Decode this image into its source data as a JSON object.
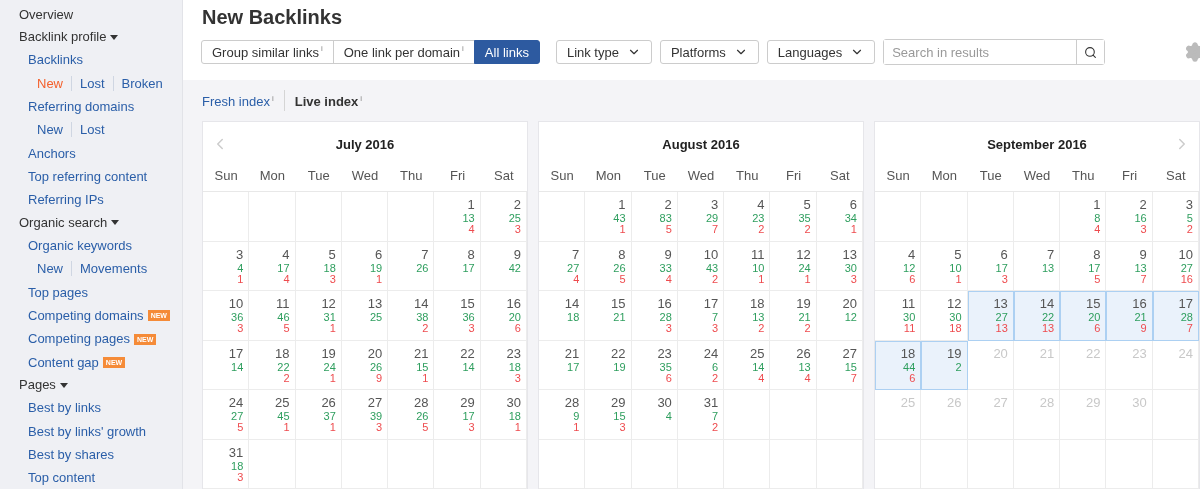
{
  "sidebar": {
    "items": [
      {
        "kind": "top",
        "label": "Overview"
      },
      {
        "kind": "section",
        "label": "Backlink profile",
        "expanded": true,
        "children": [
          {
            "kind": "link",
            "label": "Backlinks"
          },
          {
            "kind": "sublinks",
            "links": [
              {
                "label": "New",
                "selected": true
              },
              {
                "label": "Lost",
                "selected": false
              },
              {
                "label": "Broken",
                "selected": false
              }
            ]
          },
          {
            "kind": "link",
            "label": "Referring domains"
          },
          {
            "kind": "sublinks",
            "links": [
              {
                "label": "New",
                "selected": false
              },
              {
                "label": "Lost",
                "selected": false
              }
            ]
          },
          {
            "kind": "link",
            "label": "Anchors"
          },
          {
            "kind": "link",
            "label": "Top referring content"
          },
          {
            "kind": "link",
            "label": "Referring IPs"
          }
        ]
      },
      {
        "kind": "section",
        "label": "Organic search",
        "expanded": true,
        "children": [
          {
            "kind": "link",
            "label": "Organic keywords"
          },
          {
            "kind": "sublinks",
            "links": [
              {
                "label": "New",
                "selected": false
              },
              {
                "label": "Movements",
                "selected": false
              }
            ]
          },
          {
            "kind": "link",
            "label": "Top pages"
          },
          {
            "kind": "link",
            "label": "Competing domains",
            "badge": "NEW"
          },
          {
            "kind": "link",
            "label": "Competing pages",
            "badge": "NEW"
          },
          {
            "kind": "link",
            "label": "Content gap",
            "badge": "NEW"
          }
        ]
      },
      {
        "kind": "section",
        "label": "Pages",
        "expanded": true,
        "children": [
          {
            "kind": "link",
            "label": "Best by links"
          },
          {
            "kind": "link",
            "label": "Best by links' growth"
          },
          {
            "kind": "link",
            "label": "Best by shares"
          },
          {
            "kind": "link",
            "label": "Top content"
          }
        ]
      }
    ]
  },
  "header": {
    "title": "New Backlinks",
    "link_modes": [
      {
        "label": "Group similar links$^{i}$",
        "selected": false
      },
      {
        "label": "One link per domain$^{i}$",
        "selected": false
      },
      {
        "label": "All links",
        "selected": true
      }
    ],
    "filters": [
      {
        "label": "Link type"
      },
      {
        "label": "Platforms"
      },
      {
        "label": "Languages"
      }
    ],
    "search": {
      "placeholder": "Search in results"
    }
  },
  "index_tabs": [
    {
      "label": "Fresh index$^{i}$",
      "selected": false
    },
    {
      "label": "Live index$^{i}$",
      "selected": true
    }
  ],
  "calendars": [
    {
      "title": "July 2016",
      "weekdays": [
        "Sun",
        "Mon",
        "Tue",
        "Wed",
        "Thu",
        "Fri",
        "Sat"
      ],
      "weeks": [
        [
          {
            "kind": "blank"
          },
          {
            "kind": "blank"
          },
          {
            "kind": "blank"
          },
          {
            "kind": "blank"
          },
          {
            "kind": "blank"
          },
          {
            "kind": "day",
            "day": "1",
            "new": "13",
            "lost": "4",
            "selected": false
          },
          {
            "kind": "day",
            "day": "2",
            "new": "25",
            "lost": "3",
            "selected": false
          }
        ],
        [
          {
            "kind": "day",
            "day": "3",
            "new": "4",
            "lost": "1",
            "selected": false
          },
          {
            "kind": "day",
            "day": "4",
            "new": "17",
            "lost": "4",
            "selected": false
          },
          {
            "kind": "day",
            "day": "5",
            "new": "18",
            "lost": "3",
            "selected": false
          },
          {
            "kind": "day",
            "day": "6",
            "new": "19",
            "lost": "1",
            "selected": false
          },
          {
            "kind": "day",
            "day": "7",
            "new": "26",
            "selected": false
          },
          {
            "kind": "day",
            "day": "8",
            "new": "17",
            "selected": false
          },
          {
            "kind": "day",
            "day": "9",
            "new": "42",
            "selected": false
          }
        ],
        [
          {
            "kind": "day",
            "day": "10",
            "new": "36",
            "lost": "3",
            "selected": false
          },
          {
            "kind": "day",
            "day": "11",
            "new": "46",
            "lost": "5",
            "selected": false
          },
          {
            "kind": "day",
            "day": "12",
            "new": "31",
            "lost": "1",
            "selected": false
          },
          {
            "kind": "day",
            "day": "13",
            "new": "25",
            "selected": false
          },
          {
            "kind": "day",
            "day": "14",
            "new": "38",
            "lost": "2",
            "selected": false
          },
          {
            "kind": "day",
            "day": "15",
            "new": "36",
            "lost": "3",
            "selected": false
          },
          {
            "kind": "day",
            "day": "16",
            "new": "20",
            "lost": "6",
            "selected": false
          }
        ],
        [
          {
            "kind": "day",
            "day": "17",
            "new": "14",
            "selected": false
          },
          {
            "kind": "day",
            "day": "18",
            "new": "22",
            "lost": "2",
            "selected": false
          },
          {
            "kind": "day",
            "day": "19",
            "new": "24",
            "lost": "1",
            "selected": false
          },
          {
            "kind": "day",
            "day": "20",
            "new": "26",
            "lost": "9",
            "selected": false
          },
          {
            "kind": "day",
            "day": "21",
            "new": "15",
            "lost": "1",
            "selected": false
          },
          {
            "kind": "day",
            "day": "22",
            "new": "14",
            "selected": false
          },
          {
            "kind": "day",
            "day": "23",
            "new": "18",
            "lost": "3",
            "selected": false
          }
        ],
        [
          {
            "kind": "day",
            "day": "24",
            "new": "27",
            "lost": "5",
            "selected": false
          },
          {
            "kind": "day",
            "day": "25",
            "new": "45",
            "lost": "1",
            "selected": false
          },
          {
            "kind": "day",
            "day": "26",
            "new": "37",
            "lost": "1",
            "selected": false
          },
          {
            "kind": "day",
            "day": "27",
            "new": "39",
            "lost": "3",
            "selected": false
          },
          {
            "kind": "day",
            "day": "28",
            "new": "26",
            "lost": "5",
            "selected": false
          },
          {
            "kind": "day",
            "day": "29",
            "new": "17",
            "lost": "3",
            "selected": false
          },
          {
            "kind": "day",
            "day": "30",
            "new": "18",
            "lost": "1",
            "selected": false
          }
        ],
        [
          {
            "kind": "day",
            "day": "31",
            "new": "18",
            "lost": "3",
            "selected": false
          },
          {
            "kind": "blank"
          },
          {
            "kind": "blank"
          },
          {
            "kind": "blank"
          },
          {
            "kind": "blank"
          },
          {
            "kind": "blank"
          },
          {
            "kind": "blank"
          }
        ]
      ]
    },
    {
      "title": "August 2016",
      "weekdays": [
        "Sun",
        "Mon",
        "Tue",
        "Wed",
        "Thu",
        "Fri",
        "Sat"
      ],
      "weeks": [
        [
          {
            "kind": "blank"
          },
          {
            "kind": "day",
            "day": "1",
            "new": "43",
            "lost": "1",
            "selected": false
          },
          {
            "kind": "day",
            "day": "2",
            "new": "83",
            "lost": "5",
            "selected": false
          },
          {
            "kind": "day",
            "day": "3",
            "new": "29",
            "lost": "7",
            "selected": false
          },
          {
            "kind": "day",
            "day": "4",
            "new": "23",
            "lost": "2",
            "selected": false
          },
          {
            "kind": "day",
            "day": "5",
            "new": "35",
            "lost": "2",
            "selected": false
          },
          {
            "kind": "day",
            "day": "6",
            "new": "34",
            "lost": "1",
            "selected": false
          }
        ],
        [
          {
            "kind": "day",
            "day": "7",
            "new": "27",
            "lost": "4",
            "selected": false
          },
          {
            "kind": "day",
            "day": "8",
            "new": "26",
            "lost": "5",
            "selected": false
          },
          {
            "kind": "day",
            "day": "9",
            "new": "33",
            "lost": "4",
            "selected": false
          },
          {
            "kind": "day",
            "day": "10",
            "new": "43",
            "lost": "2",
            "selected": false
          },
          {
            "kind": "day",
            "day": "11",
            "new": "10",
            "lost": "1",
            "selected": false
          },
          {
            "kind": "day",
            "day": "12",
            "new": "24",
            "lost": "1",
            "selected": false
          },
          {
            "kind": "day",
            "day": "13",
            "new": "30",
            "lost": "3",
            "selected": false
          }
        ],
        [
          {
            "kind": "day",
            "day": "14",
            "new": "18",
            "selected": false
          },
          {
            "kind": "day",
            "day": "15",
            "new": "21",
            "selected": false
          },
          {
            "kind": "day",
            "day": "16",
            "new": "28",
            "lost": "3",
            "selected": false
          },
          {
            "kind": "day",
            "day": "17",
            "new": "7",
            "lost": "3",
            "selected": false
          },
          {
            "kind": "day",
            "day": "18",
            "new": "13",
            "lost": "2",
            "selected": false
          },
          {
            "kind": "day",
            "day": "19",
            "new": "21",
            "lost": "2",
            "selected": false
          },
          {
            "kind": "day",
            "day": "20",
            "new": "12",
            "selected": false
          }
        ],
        [
          {
            "kind": "day",
            "day": "21",
            "new": "17",
            "selected": false
          },
          {
            "kind": "day",
            "day": "22",
            "new": "19",
            "selected": false
          },
          {
            "kind": "day",
            "day": "23",
            "new": "35",
            "lost": "6",
            "selected": false
          },
          {
            "kind": "day",
            "day": "24",
            "new": "6",
            "lost": "2",
            "selected": false
          },
          {
            "kind": "day",
            "day": "25",
            "new": "14",
            "lost": "4",
            "selected": false
          },
          {
            "kind": "day",
            "day": "26",
            "new": "13",
            "lost": "4",
            "selected": false
          },
          {
            "kind": "day",
            "day": "27",
            "new": "15",
            "lost": "7",
            "selected": false
          }
        ],
        [
          {
            "kind": "day",
            "day": "28",
            "new": "9",
            "lost": "1",
            "selected": false
          },
          {
            "kind": "day",
            "day": "29",
            "new": "15",
            "lost": "3",
            "selected": false
          },
          {
            "kind": "day",
            "day": "30",
            "new": "4",
            "selected": false
          },
          {
            "kind": "day",
            "day": "31",
            "new": "7",
            "lost": "2",
            "selected": false
          },
          {
            "kind": "blank"
          },
          {
            "kind": "blank"
          },
          {
            "kind": "blank"
          }
        ],
        [
          {
            "kind": "blank"
          },
          {
            "kind": "blank"
          },
          {
            "kind": "blank"
          },
          {
            "kind": "blank"
          },
          {
            "kind": "blank"
          },
          {
            "kind": "blank"
          },
          {
            "kind": "blank"
          }
        ]
      ]
    },
    {
      "title": "September 2016",
      "weekdays": [
        "Sun",
        "Mon",
        "Tue",
        "Wed",
        "Thu",
        "Fri",
        "Sat"
      ],
      "weeks": [
        [
          {
            "kind": "blank"
          },
          {
            "kind": "blank"
          },
          {
            "kind": "blank"
          },
          {
            "kind": "blank"
          },
          {
            "kind": "day",
            "day": "1",
            "new": "8",
            "lost": "4",
            "selected": false
          },
          {
            "kind": "day",
            "day": "2",
            "new": "16",
            "lost": "3",
            "selected": false
          },
          {
            "kind": "day",
            "day": "3",
            "new": "5",
            "lost": "2",
            "selected": false
          }
        ],
        [
          {
            "kind": "day",
            "day": "4",
            "new": "12",
            "lost": "6",
            "selected": false
          },
          {
            "kind": "day",
            "day": "5",
            "new": "10",
            "lost": "1",
            "selected": false
          },
          {
            "kind": "day",
            "day": "6",
            "new": "17",
            "lost": "3",
            "selected": false
          },
          {
            "kind": "day",
            "day": "7",
            "new": "13",
            "selected": false
          },
          {
            "kind": "day",
            "day": "8",
            "new": "17",
            "lost": "5",
            "selected": false
          },
          {
            "kind": "day",
            "day": "9",
            "new": "13",
            "lost": "7",
            "selected": false
          },
          {
            "kind": "day",
            "day": "10",
            "new": "27",
            "lost": "16",
            "selected": false
          }
        ],
        [
          {
            "kind": "day",
            "day": "11",
            "new": "30",
            "lost": "11",
            "selected": false
          },
          {
            "kind": "day",
            "day": "12",
            "new": "30",
            "lost": "18",
            "selected": false
          },
          {
            "kind": "day",
            "day": "13",
            "new": "27",
            "lost": "13",
            "selected": true
          },
          {
            "kind": "day",
            "day": "14",
            "new": "22",
            "lost": "13",
            "selected": true
          },
          {
            "kind": "day",
            "day": "15",
            "new": "20",
            "lost": "6",
            "selected": true
          },
          {
            "kind": "day",
            "day": "16",
            "new": "21",
            "lost": "9",
            "selected": true
          },
          {
            "kind": "day",
            "day": "17",
            "new": "28",
            "lost": "7",
            "selected": true
          }
        ],
        [
          {
            "kind": "day",
            "day": "18",
            "new": "44",
            "lost": "6",
            "selected": true
          },
          {
            "kind": "day",
            "day": "19",
            "new": "2",
            "selected": true
          },
          {
            "kind": "future",
            "day": "20"
          },
          {
            "kind": "future",
            "day": "21"
          },
          {
            "kind": "future",
            "day": "22"
          },
          {
            "kind": "future",
            "day": "23"
          },
          {
            "kind": "future",
            "day": "24"
          }
        ],
        [
          {
            "kind": "future",
            "day": "25"
          },
          {
            "kind": "future",
            "day": "26"
          },
          {
            "kind": "future",
            "day": "27"
          },
          {
            "kind": "future",
            "day": "28"
          },
          {
            "kind": "future",
            "day": "29"
          },
          {
            "kind": "future",
            "day": "30"
          },
          {
            "kind": "blank"
          }
        ],
        [
          {
            "kind": "blank"
          },
          {
            "kind": "blank"
          },
          {
            "kind": "blank"
          },
          {
            "kind": "blank"
          },
          {
            "kind": "blank"
          },
          {
            "kind": "blank"
          },
          {
            "kind": "blank"
          }
        ]
      ]
    }
  ]
}
